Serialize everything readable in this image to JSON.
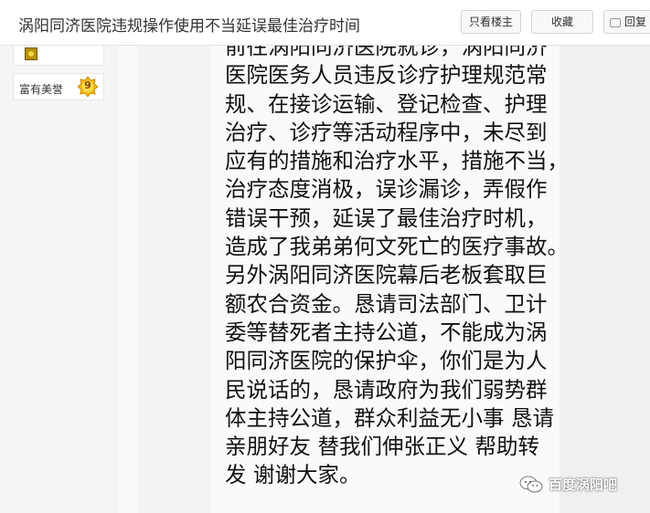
{
  "header": {
    "title": "涡阳同济医院违规操作使用不当延误最佳治疗时间",
    "only_author_label": "只看楼主",
    "favorite_label": "收藏",
    "reply_label": "回复"
  },
  "sidebar": {
    "medal_icon": "medal-icon",
    "level_name": "富有美誉",
    "level_number": "9"
  },
  "post": {
    "lines": [
      "前往涡阳同济医院就诊，涡阳同济",
      "医院医务人员违反诊疗护理规范常",
      "规、在接诊运输、登记检查、护理",
      "治疗、诊疗等活动程序中，未尽到",
      "应有的措施和治疗水平，措施不当，",
      "治疗态度消极，误诊漏诊，弄假作",
      "错误干预，延误了最佳治疗时机，",
      "造成了我弟弟何文死亡的医疗事故。",
      "另外涡阳同济医院幕后老板套取巨",
      "额农合资金。恳请司法部门、卫计",
      "委等替死者主持公道，不能成为涡",
      "阳同济医院的保护伞，你们是为人",
      "民说话的，恳请政府为我们弱势群",
      "体主持公道，群众利益无小事 恳请",
      "亲朋好友 替我们伸张正义 帮助转",
      "发 谢谢大家。"
    ]
  },
  "watermark": {
    "text": "百度涡阳吧",
    "icon": "wechat-icon"
  },
  "colors": {
    "page_background": "#f5f5f5",
    "post_background": "#fafafa",
    "text": "#111111",
    "level_badge": "#f0b90b"
  }
}
